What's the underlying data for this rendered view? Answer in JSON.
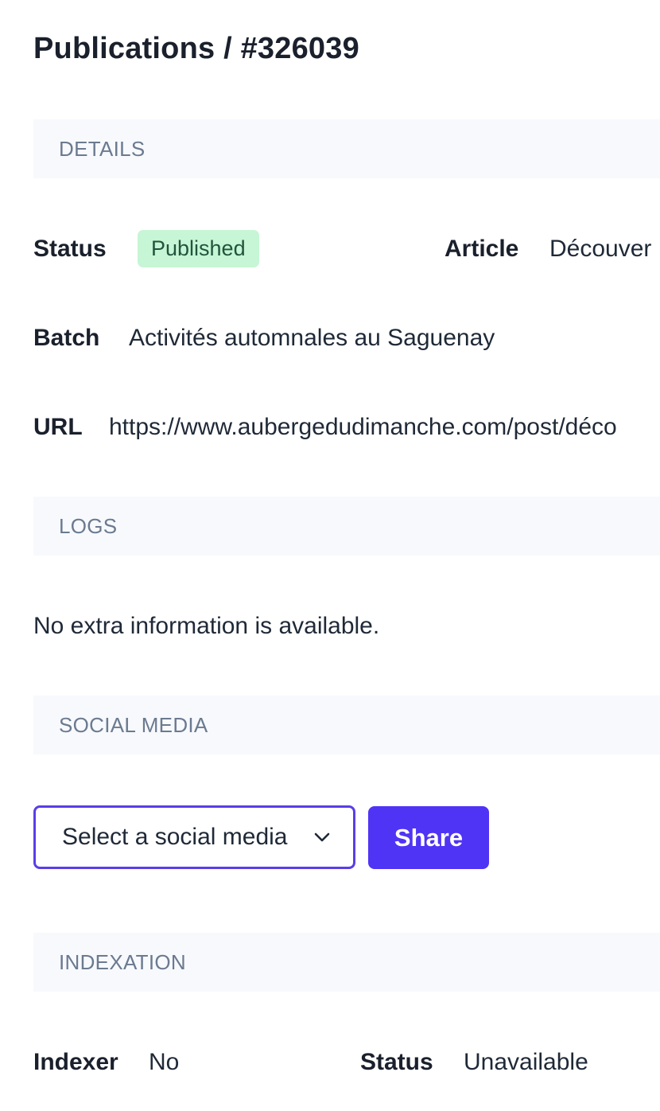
{
  "page": {
    "title": "Publications / #326039"
  },
  "details": {
    "header": "DETAILS",
    "status_label": "Status",
    "status_value": "Published",
    "article_label": "Article",
    "article_value": "Découver",
    "batch_label": "Batch",
    "batch_value": "Activités automnales au Saguenay",
    "url_label": "URL",
    "url_value": "https://www.aubergedudimanche.com/post/déco"
  },
  "logs": {
    "header": "LOGS",
    "empty_text": "No extra information is available."
  },
  "social_media": {
    "header": "SOCIAL MEDIA",
    "select_value": "Select a social media",
    "share_label": "Share"
  },
  "indexation": {
    "header": "INDEXATION",
    "indexer_label": "Indexer",
    "indexer_value": "No",
    "status_label": "Status",
    "status_value": "Unavailable"
  },
  "colors": {
    "accent": "#4f34f5",
    "badge_bg": "#c6f6d5",
    "badge_text": "#22543d",
    "section_bg": "#f7f9fc",
    "section_text": "#6b7a90"
  }
}
